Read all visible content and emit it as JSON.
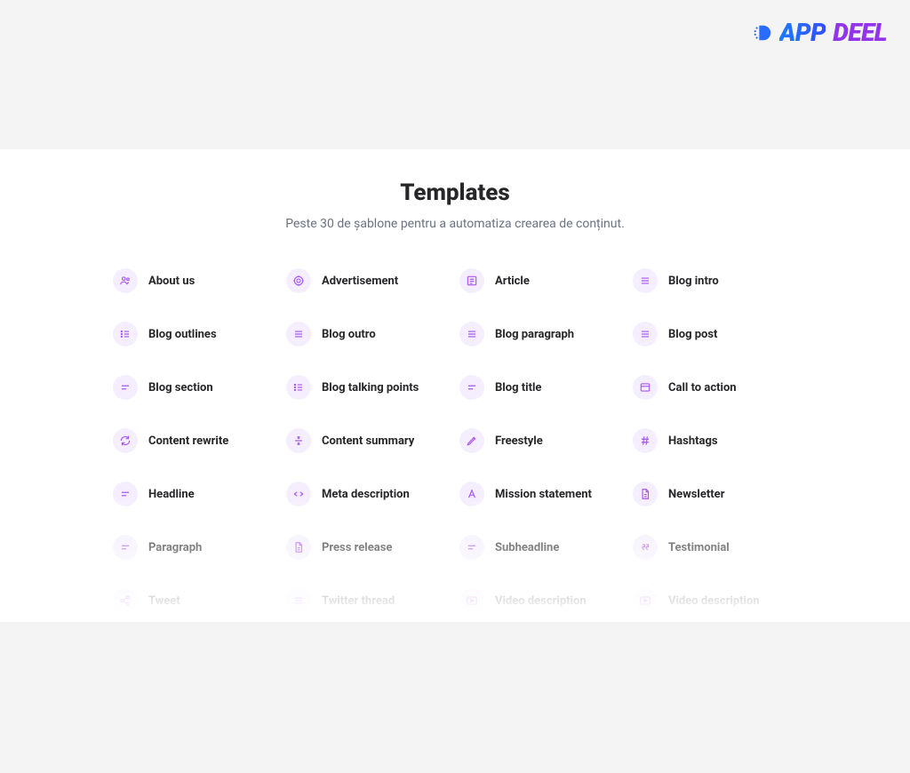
{
  "logo": {
    "part1": "APP",
    "part2": "DEEL"
  },
  "header": {
    "title": "Templates",
    "subtitle": "Peste 30 de șablone pentru a automatiza crearea de conținut."
  },
  "colors": {
    "icon_bg": "#f5eefe",
    "icon_stroke": "#a855f7"
  },
  "templates": [
    {
      "icon": "users",
      "label": "About us"
    },
    {
      "icon": "target",
      "label": "Advertisement"
    },
    {
      "icon": "article",
      "label": "Article"
    },
    {
      "icon": "list-equal",
      "label": "Blog intro"
    },
    {
      "icon": "list-bullets",
      "label": "Blog outlines"
    },
    {
      "icon": "list-equal",
      "label": "Blog outro"
    },
    {
      "icon": "list-equal",
      "label": "Blog paragraph"
    },
    {
      "icon": "list-equal",
      "label": "Blog post"
    },
    {
      "icon": "lines",
      "label": "Blog section"
    },
    {
      "icon": "list-bullets",
      "label": "Blog talking points"
    },
    {
      "icon": "lines",
      "label": "Blog title"
    },
    {
      "icon": "window",
      "label": "Call to action"
    },
    {
      "icon": "refresh",
      "label": "Content rewrite"
    },
    {
      "icon": "divide",
      "label": "Content summary"
    },
    {
      "icon": "pen",
      "label": "Freestyle"
    },
    {
      "icon": "hash",
      "label": "Hashtags"
    },
    {
      "icon": "lines",
      "label": "Headline"
    },
    {
      "icon": "code",
      "label": "Meta description"
    },
    {
      "icon": "a",
      "label": "Mission statement"
    },
    {
      "icon": "doc",
      "label": "Newsletter"
    },
    {
      "icon": "lines",
      "label": "Paragraph"
    },
    {
      "icon": "doc",
      "label": "Press release"
    },
    {
      "icon": "lines",
      "label": "Subheadline"
    },
    {
      "icon": "quote",
      "label": "Testimonial"
    },
    {
      "icon": "share",
      "label": "Tweet"
    },
    {
      "icon": "list-equal",
      "label": "Twitter thread"
    },
    {
      "icon": "play",
      "label": "Video description"
    },
    {
      "icon": "play",
      "label": "Video description"
    }
  ]
}
